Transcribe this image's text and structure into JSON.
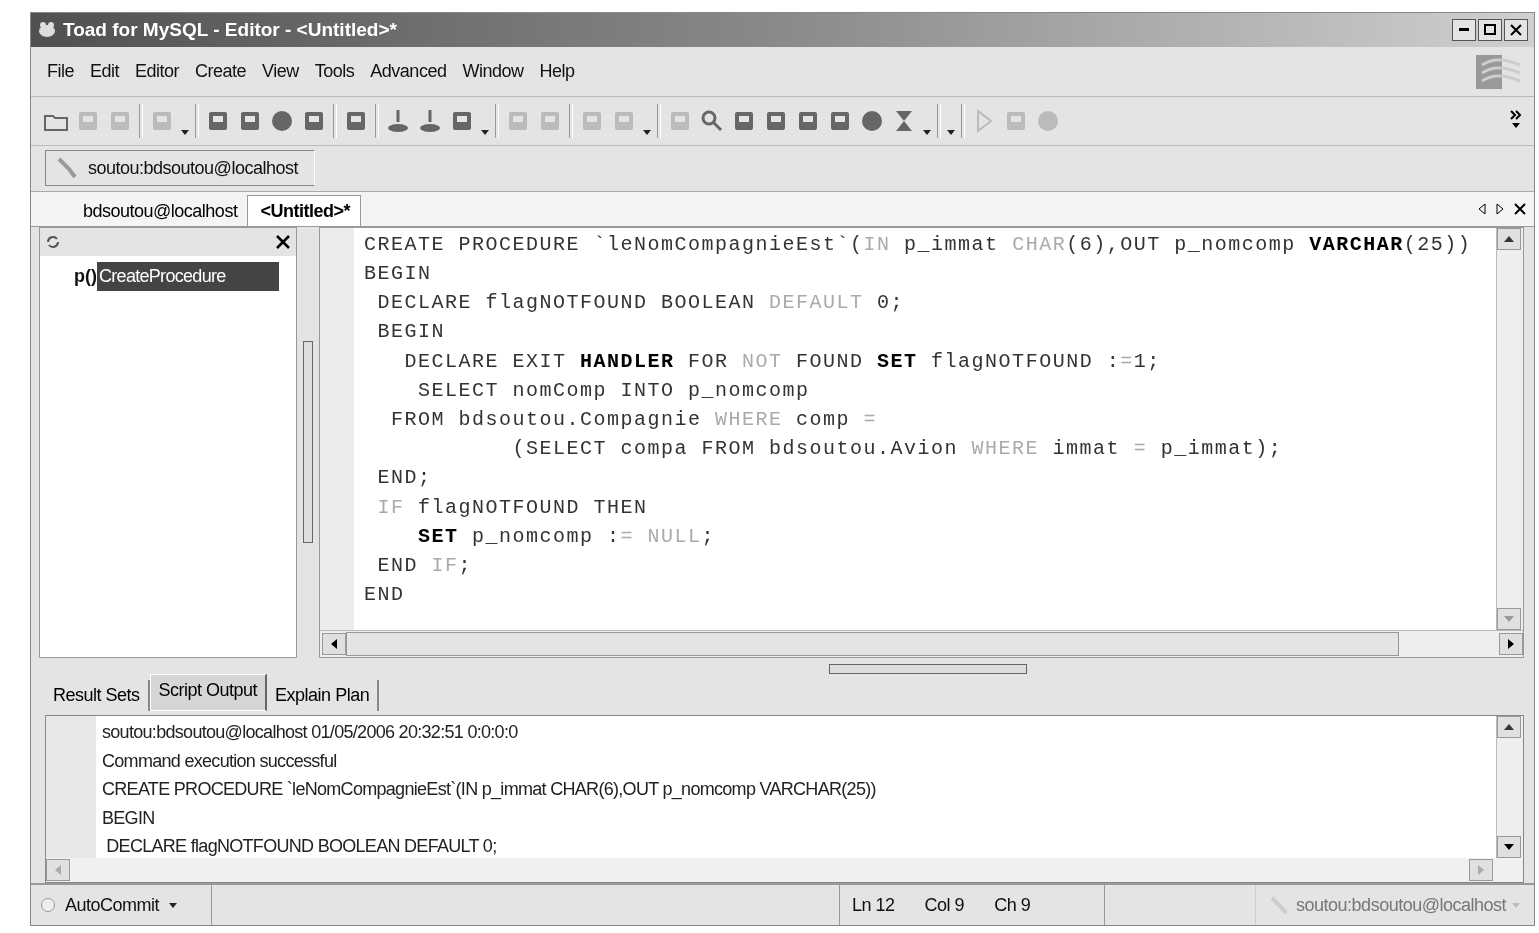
{
  "window": {
    "title": "Toad for MySQL - Editor - <Untitled>*"
  },
  "menu": [
    "File",
    "Edit",
    "Editor",
    "Create",
    "View",
    "Tools",
    "Advanced",
    "Window",
    "Help"
  ],
  "connection_tab": {
    "label": "soutou:bdsoutou@localhost"
  },
  "document_tabs": [
    {
      "label": "bdsoutou@localhost",
      "selected": false
    },
    {
      "label": "<Untitled>*",
      "selected": true
    }
  ],
  "tree": {
    "items": [
      {
        "prefix": "p()",
        "label": "CreateProcedure",
        "selected": true
      }
    ]
  },
  "editor": {
    "lines": [
      [
        {
          "text": "CREATE PROCEDURE `leNomCompagnieEst`(",
          "kind": "plain"
        },
        {
          "text": "IN",
          "kind": "dim"
        },
        {
          "text": " p_immat ",
          "kind": "plain"
        },
        {
          "text": "CHAR",
          "kind": "dim"
        },
        {
          "text": "(6),OUT p_nomcomp ",
          "kind": "plain"
        },
        {
          "text": "VARCHAR",
          "kind": "bold"
        },
        {
          "text": "(25))",
          "kind": "plain"
        }
      ],
      [
        {
          "text": "BEGIN",
          "kind": "plain"
        }
      ],
      [
        {
          "text": " DECLARE flagNOTFOUND BOOLEAN ",
          "kind": "plain"
        },
        {
          "text": "DEFAULT",
          "kind": "dim"
        },
        {
          "text": " 0;",
          "kind": "plain"
        }
      ],
      [
        {
          "text": " BEGIN",
          "kind": "plain"
        }
      ],
      [
        {
          "text": "   DECLARE EXIT ",
          "kind": "plain"
        },
        {
          "text": "HANDLER",
          "kind": "bold"
        },
        {
          "text": " FOR ",
          "kind": "plain"
        },
        {
          "text": "NOT",
          "kind": "dim"
        },
        {
          "text": " FOUND ",
          "kind": "plain"
        },
        {
          "text": "SET",
          "kind": "bold"
        },
        {
          "text": " flagNOTFOUND :",
          "kind": "plain"
        },
        {
          "text": "=",
          "kind": "dim"
        },
        {
          "text": "1;",
          "kind": "plain"
        }
      ],
      [
        {
          "text": "    SELECT nomComp INTO p_nomcomp",
          "kind": "plain"
        }
      ],
      [
        {
          "text": "  FROM bdsoutou.Compagnie ",
          "kind": "plain"
        },
        {
          "text": "WHERE",
          "kind": "dim"
        },
        {
          "text": " comp ",
          "kind": "plain"
        },
        {
          "text": "=",
          "kind": "dim"
        }
      ],
      [
        {
          "text": "           (SELECT compa FROM bdsoutou.Avion ",
          "kind": "plain"
        },
        {
          "text": "WHERE",
          "kind": "dim"
        },
        {
          "text": " immat ",
          "kind": "plain"
        },
        {
          "text": "=",
          "kind": "dim"
        },
        {
          "text": " p_immat);",
          "kind": "plain"
        }
      ],
      [
        {
          "text": " END;",
          "kind": "plain"
        }
      ],
      [
        {
          "text": " IF",
          "kind": "dim"
        },
        {
          "text": " flagNOTFOUND THEN",
          "kind": "plain"
        }
      ],
      [
        {
          "text": "    SET",
          "kind": "bold"
        },
        {
          "text": " p_nomcomp :",
          "kind": "plain"
        },
        {
          "text": "= NULL",
          "kind": "dim"
        },
        {
          "text": ";",
          "kind": "plain"
        }
      ],
      [
        {
          "text": " END ",
          "kind": "plain"
        },
        {
          "text": "IF",
          "kind": "dim"
        },
        {
          "text": ";",
          "kind": "plain"
        }
      ],
      [
        {
          "text": "END",
          "kind": "plain"
        }
      ]
    ]
  },
  "output_tabs": [
    {
      "label": "Result Sets",
      "selected": false
    },
    {
      "label": "Script Output",
      "selected": true
    },
    {
      "label": "Explain Plan",
      "selected": false
    }
  ],
  "output_lines": [
    "soutou:bdsoutou@localhost 01/05/2006 20:32:51 0:0:0:0",
    "Command execution successful",
    "CREATE PROCEDURE `leNomCompagnieEst`(IN p_immat CHAR(6),OUT p_nomcomp VARCHAR(25))",
    "BEGIN",
    " DECLARE flagNOTFOUND BOOLEAN DEFAULT 0;"
  ],
  "status_bar": {
    "autocommit": {
      "label": "AutoCommit",
      "checked": false
    },
    "line": "Ln 12",
    "column": "Col 9",
    "char": "Ch 9",
    "connection": {
      "label": "soutou:bdsoutou@localhost",
      "disabled": true
    }
  }
}
